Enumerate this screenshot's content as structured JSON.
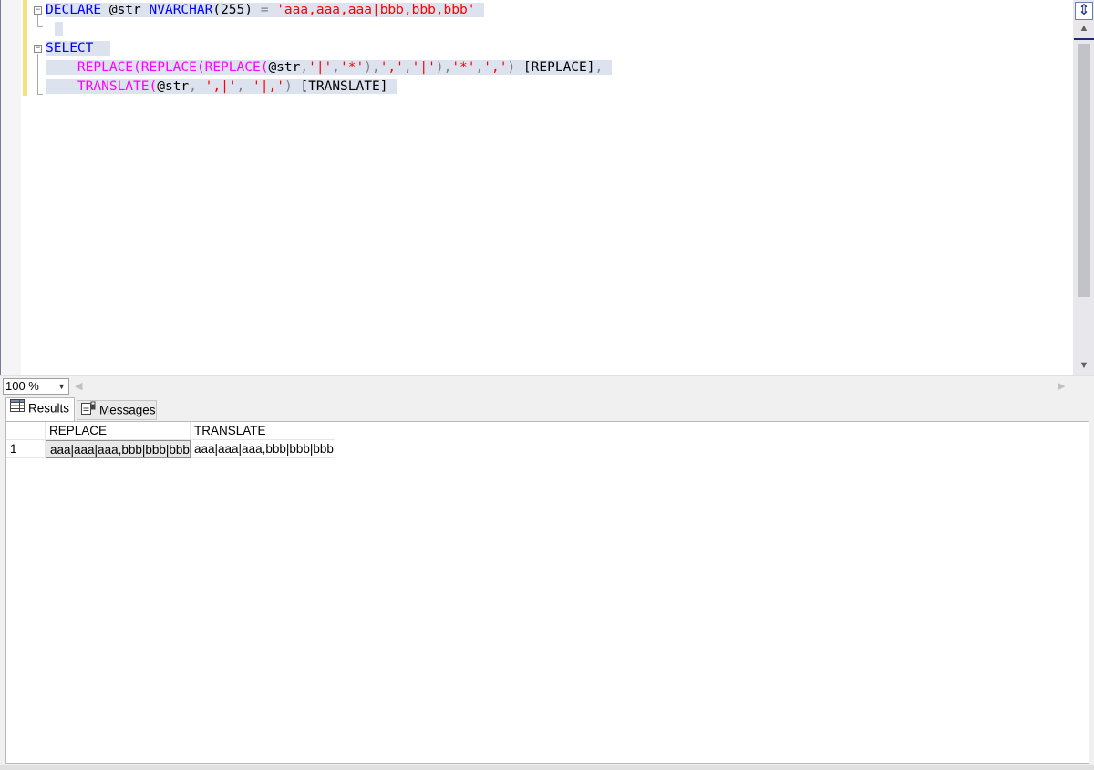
{
  "editor": {
    "lines": [
      {
        "segments": [
          {
            "t": "DECLARE",
            "c": "kw"
          },
          {
            "t": " @str ",
            "c": "id"
          },
          {
            "t": "NVARCHAR",
            "c": "kw"
          },
          {
            "t": "(255) ",
            "c": "id"
          },
          {
            "t": "=",
            "c": "op"
          },
          {
            "t": " ",
            "c": "id"
          },
          {
            "t": "'aaa,aaa,aaa|bbb,bbb,bbb'",
            "c": "str"
          }
        ]
      },
      {
        "segments": []
      },
      {
        "segments": [
          {
            "t": "SELECT",
            "c": "kw"
          },
          {
            "t": " ",
            "c": "id"
          }
        ]
      },
      {
        "segments": [
          {
            "t": "    ",
            "c": "id"
          },
          {
            "t": "REPLACE(REPLACE(REPLACE(",
            "c": "fn"
          },
          {
            "t": "@str",
            "c": "id"
          },
          {
            "t": ",",
            "c": "op"
          },
          {
            "t": "'|'",
            "c": "str"
          },
          {
            "t": ",",
            "c": "op"
          },
          {
            "t": "'*'",
            "c": "str"
          },
          {
            "t": "),",
            "c": "op"
          },
          {
            "t": "','",
            "c": "str"
          },
          {
            "t": ",",
            "c": "op"
          },
          {
            "t": "'|'",
            "c": "str"
          },
          {
            "t": "),",
            "c": "op"
          },
          {
            "t": "'*'",
            "c": "str"
          },
          {
            "t": ",",
            "c": "op"
          },
          {
            "t": "','",
            "c": "str"
          },
          {
            "t": ")",
            "c": "op"
          },
          {
            "t": " [REPLACE]",
            "c": "id"
          },
          {
            "t": ",",
            "c": "op"
          }
        ]
      },
      {
        "segments": [
          {
            "t": "    ",
            "c": "id"
          },
          {
            "t": "TRANSLATE(",
            "c": "fn"
          },
          {
            "t": "@str",
            "c": "id"
          },
          {
            "t": ", ",
            "c": "op"
          },
          {
            "t": "',|'",
            "c": "str"
          },
          {
            "t": ", ",
            "c": "op"
          },
          {
            "t": "'|,'",
            "c": "str"
          },
          {
            "t": ")",
            "c": "op"
          },
          {
            "t": " [TRANSLATE]",
            "c": "id"
          }
        ]
      }
    ],
    "fold_marker": "−"
  },
  "zoom": {
    "value": "100 %",
    "caret": "▼"
  },
  "scroll": {
    "up": "▲",
    "down": "▼",
    "left": "◀",
    "right": "▶",
    "split": "⇕"
  },
  "tabs": {
    "results": "Results",
    "messages": "Messages"
  },
  "grid": {
    "columns": [
      "REPLACE",
      "TRANSLATE"
    ],
    "rows": [
      {
        "num": "1",
        "cells": [
          "aaa|aaa|aaa,bbb|bbb|bbb",
          "aaa|aaa|aaa,bbb|bbb|bbb"
        ]
      }
    ]
  },
  "colors": {
    "keyword": "#0000ff",
    "function": "#ff00ff",
    "string": "#ff0000",
    "operator": "#808080",
    "selection": "#dde3ee"
  }
}
